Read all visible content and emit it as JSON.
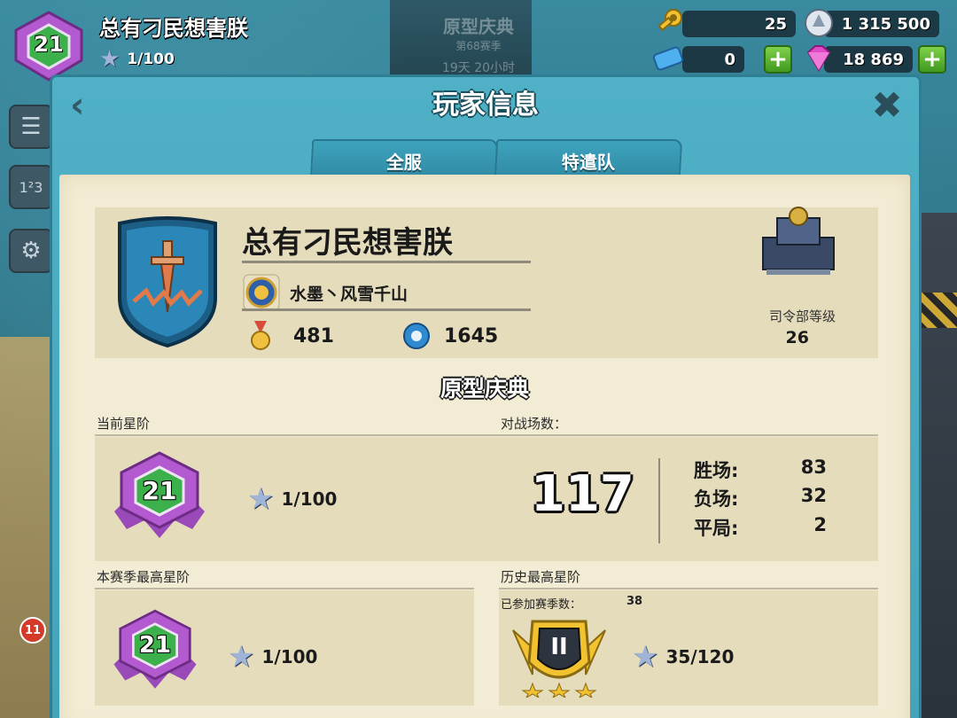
{
  "top_bar": {
    "player_rank": "21",
    "player_name": "总有刁民想害朕",
    "stars": "1/100",
    "keys": "25",
    "tickets": "0",
    "intel": "1 315 500",
    "diamonds": "18 869"
  },
  "background": {
    "season_title": "原型庆典",
    "season_sub": "第68赛季",
    "season_time": "19天 20小时",
    "side_badge": "11"
  },
  "modal": {
    "title": "玩家信息",
    "tabs": [
      "全服",
      "特遣队"
    ]
  },
  "profile": {
    "name": "总有刁民想害朕",
    "task_force": "水墨丶风雪千山",
    "medals": "481",
    "victory_points": "1645",
    "hq_label": "司令部等级",
    "hq_level": "26"
  },
  "season": {
    "title": "原型庆典",
    "current_rank_label": "当前星阶",
    "current_rank": "21",
    "current_stars": "1/100",
    "battles_label": "对战场数：",
    "battles_total": "117",
    "wins_label": "胜场:",
    "wins": "83",
    "losses_label": "负场:",
    "losses": "32",
    "draws_label": "平局:",
    "draws": "2",
    "season_best_label": "本赛季最高星阶",
    "season_best_rank": "21",
    "season_best_stars": "1/100",
    "all_time_label": "历史最高星阶",
    "seasons_played_label": "已参加赛季数：",
    "seasons_played": "38",
    "all_time_tier": "II",
    "all_time_stars": "35/120"
  },
  "colors": {
    "modal_blue": "#4fb0c6",
    "parchment": "#f2ecd4",
    "panel": "#e5dcbc",
    "badge_purple": "#b45ad0",
    "badge_green": "#3cb04a",
    "plus_green": "#5cb832"
  },
  "icons": [
    "key-icon",
    "ticket-icon",
    "intel-icon",
    "diamond-icon",
    "star-icon",
    "medal-icon",
    "gear-icon",
    "back-arrow-icon",
    "close-icon",
    "shield-icon",
    "hq-icon",
    "rank-badge-icon",
    "tier-badge-icon"
  ]
}
